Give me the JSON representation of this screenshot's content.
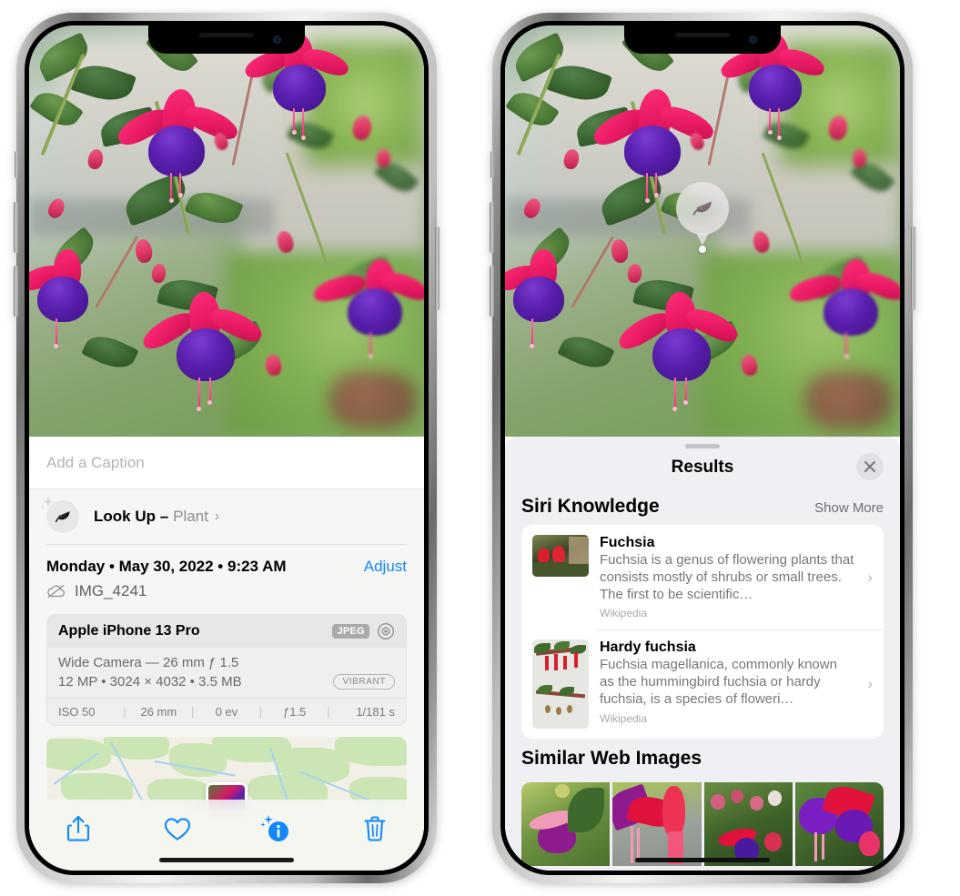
{
  "left_phone": {
    "caption": {
      "placeholder": "Add a Caption",
      "value": ""
    },
    "lookup": {
      "icon": "leaf-icon",
      "sparkle_icon": "sparkle-icon",
      "label": "Look Up –",
      "subject": "Plant",
      "chevron": "›"
    },
    "meta": {
      "date": "Monday • May 30, 2022 • 9:23 AM",
      "adjust_label": "Adjust",
      "cloud_icon": "cloud-slash-icon",
      "filename": "IMG_4241"
    },
    "exif": {
      "device": "Apple iPhone 13 Pro",
      "format_badge": "JPEG",
      "aperture_icon": "aperture-icon",
      "lens_line": "Wide Camera — 26 mm ƒ 1.5",
      "size_line": "12 MP • 3024 × 4032 • 3.5 MB",
      "style_badge": "VIBRANT",
      "stats": [
        "ISO 50",
        "26 mm",
        "0 ev",
        "ƒ1.5",
        "1/181 s"
      ]
    },
    "map": {
      "pin_label": "photo-pin"
    },
    "toolbar": [
      {
        "name": "share-button",
        "icon": "share-icon",
        "active": false
      },
      {
        "name": "favorite-button",
        "icon": "heart-icon",
        "active": false
      },
      {
        "name": "info-button",
        "icon": "info-sparkle-icon",
        "active": true
      },
      {
        "name": "delete-button",
        "icon": "trash-icon",
        "active": false
      }
    ]
  },
  "right_phone": {
    "detection": {
      "icon": "leaf-icon",
      "label": "plant-detected-badge"
    },
    "sheet": {
      "title": "Results",
      "close_icon": "close-icon",
      "sections": [
        {
          "title": "Siri Knowledge",
          "action": "Show More",
          "items": [
            {
              "title": "Fuchsia",
              "description": "Fuchsia is a genus of flowering plants that consists mostly of shrubs or small trees. The first to be scientific…",
              "source": "Wikipedia",
              "thumb": "fuchsia-red-flowers-thumbnail"
            },
            {
              "title": "Hardy fuchsia",
              "description": "Fuchsia magellanica, commonly known as the hummingbird fuchsia or hardy fuchsia, is a species of floweri…",
              "source": "Wikipedia",
              "thumb": "hardy-fuchsia-specimen-thumbnail"
            }
          ]
        },
        {
          "title": "Similar Web Images",
          "images": [
            "fuchsia-pink-purple-on-green",
            "fuchsia-red-closeup",
            "fuchsia-buds-bush",
            "fuchsia-purple-red-cluster"
          ]
        }
      ]
    }
  },
  "colors": {
    "accent_blue": "#1287fb",
    "sheet_bg": "#f0eff4",
    "panel_bg": "#f6f6f4",
    "card_white": "#ffffff",
    "muted_text": "#8e8e93",
    "flower_pink": "#e81a63",
    "flower_purple": "#5a1fae",
    "leaf_green": "#4d7b38"
  }
}
